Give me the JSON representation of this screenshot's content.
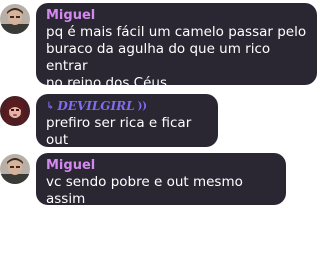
{
  "chat": {
    "messages": [
      {
        "author": "Miguel",
        "lines": [
          "pq é mais fácil um camelo passar pelo",
          "buraco da agulha do que um rico entrar",
          "no reino dos Céus"
        ]
      },
      {
        "author": "DEVILGIRL",
        "author_prefix": "↳",
        "author_suffix": "))",
        "lines": [
          "prefiro ser rica e ficar out"
        ]
      },
      {
        "author": "Miguel",
        "lines": [
          "vc sendo pobre e out mesmo assim"
        ]
      }
    ]
  },
  "colors": {
    "bubble": "#2a2733",
    "author_name": "#d189ee",
    "fancy_author": "#7f6df0",
    "text": "#ffffff"
  },
  "icons": {
    "avatar_miguel": "person-avatar",
    "avatar_devilgirl": "person-avatar"
  }
}
